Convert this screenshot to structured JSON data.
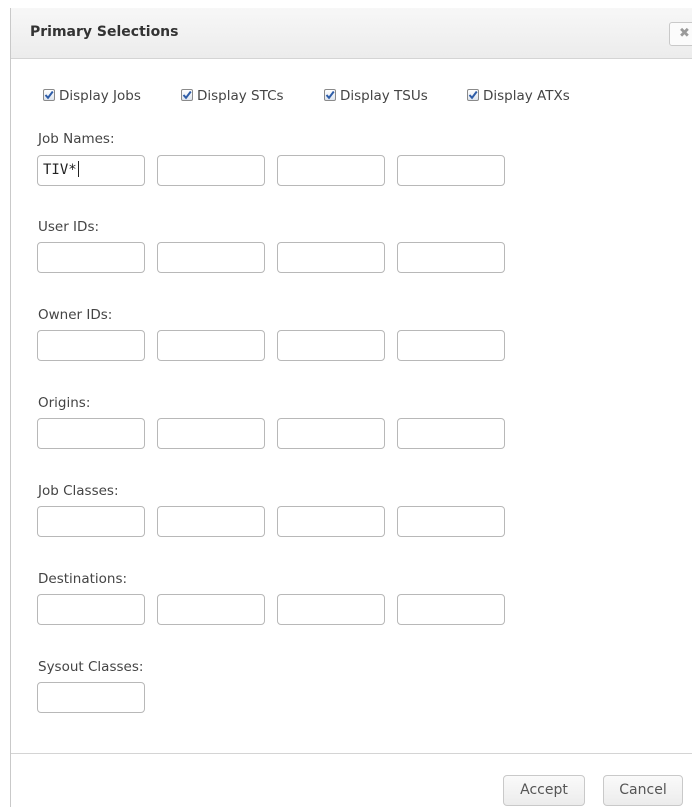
{
  "dialog": {
    "title": "Primary Selections",
    "close_label": "✖"
  },
  "display_options": [
    {
      "label": "Display Jobs",
      "checked": true
    },
    {
      "label": "Display STCs",
      "checked": true
    },
    {
      "label": "Display TSUs",
      "checked": true
    },
    {
      "label": "Display ATXs",
      "checked": true
    }
  ],
  "groups": [
    {
      "label": "Job Names:",
      "values": [
        "TIV*",
        "",
        "",
        ""
      ]
    },
    {
      "label": "User IDs:",
      "values": [
        "",
        "",
        "",
        ""
      ]
    },
    {
      "label": "Owner IDs:",
      "values": [
        "",
        "",
        "",
        ""
      ]
    },
    {
      "label": "Origins:",
      "values": [
        "",
        "",
        "",
        ""
      ]
    },
    {
      "label": "Job Classes:",
      "values": [
        "",
        "",
        "",
        ""
      ]
    },
    {
      "label": "Destinations:",
      "values": [
        "",
        "",
        "",
        ""
      ]
    },
    {
      "label": "Sysout Classes:",
      "values": [
        ""
      ]
    }
  ],
  "footer": {
    "accept_label": "Accept",
    "cancel_label": "Cancel"
  },
  "colors": {
    "title_bar": "#efefef",
    "border": "#b8b8b8",
    "checkmark": "#2e5da8"
  }
}
